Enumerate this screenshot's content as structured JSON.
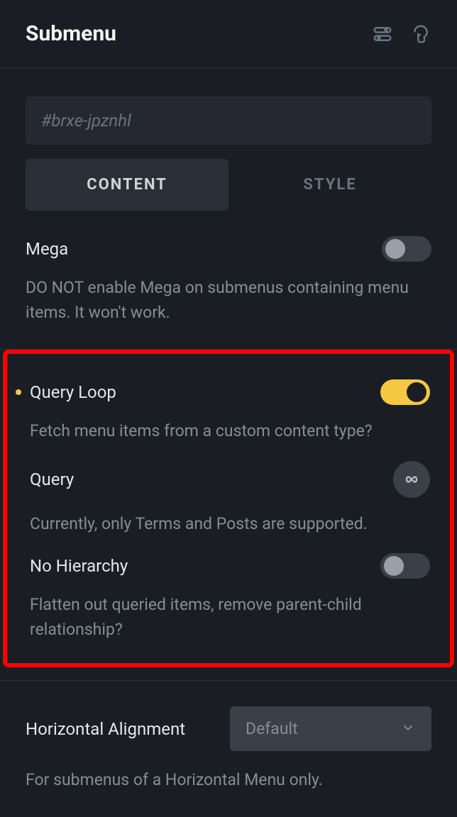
{
  "header": {
    "title": "Submenu"
  },
  "element_id": "#brxe-jpznhl",
  "tabs": {
    "content": "CONTENT",
    "style": "STYLE"
  },
  "mega": {
    "label": "Mega",
    "description": "DO NOT enable Mega on submenus containing menu items. It won't work.",
    "enabled": false
  },
  "query_loop": {
    "label": "Query Loop",
    "description": "Fetch menu items from a custom content type?",
    "enabled": true
  },
  "query": {
    "label": "Query",
    "description": "Currently, only Terms and Posts are supported."
  },
  "no_hierarchy": {
    "label": "No Hierarchy",
    "description": "Flatten out queried items, remove parent-child relationship?",
    "enabled": false
  },
  "horizontal_alignment": {
    "label": "Horizontal Alignment",
    "value": "Default",
    "description": "For submenus of a Horizontal Menu only."
  }
}
